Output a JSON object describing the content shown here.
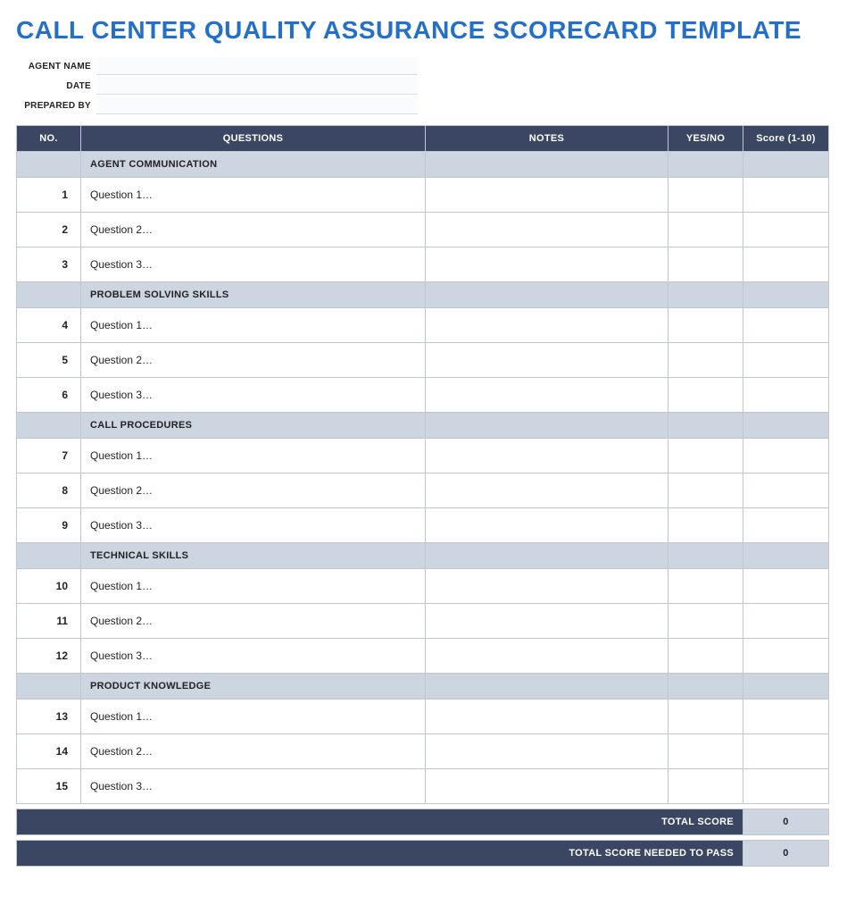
{
  "title": "CALL CENTER QUALITY ASSURANCE SCORECARD TEMPLATE",
  "meta": {
    "agent_name_label": "AGENT NAME",
    "agent_name_value": "",
    "date_label": "DATE",
    "date_value": "",
    "prepared_by_label": "PREPARED BY",
    "prepared_by_value": ""
  },
  "headers": {
    "no": "NO.",
    "questions": "QUESTIONS",
    "notes": "NOTES",
    "yes_no": "YES/NO",
    "score": "Score (1-10)"
  },
  "sections": [
    {
      "title": "AGENT COMMUNICATION",
      "rows": [
        {
          "no": "1",
          "question": "Question 1…",
          "notes": "",
          "yes_no": "",
          "score": ""
        },
        {
          "no": "2",
          "question": "Question 2…",
          "notes": "",
          "yes_no": "",
          "score": ""
        },
        {
          "no": "3",
          "question": "Question 3…",
          "notes": "",
          "yes_no": "",
          "score": ""
        }
      ]
    },
    {
      "title": "PROBLEM SOLVING SKILLS",
      "rows": [
        {
          "no": "4",
          "question": "Question 1…",
          "notes": "",
          "yes_no": "",
          "score": ""
        },
        {
          "no": "5",
          "question": "Question 2…",
          "notes": "",
          "yes_no": "",
          "score": ""
        },
        {
          "no": "6",
          "question": "Question 3…",
          "notes": "",
          "yes_no": "",
          "score": ""
        }
      ]
    },
    {
      "title": "CALL PROCEDURES",
      "rows": [
        {
          "no": "7",
          "question": "Question 1…",
          "notes": "",
          "yes_no": "",
          "score": ""
        },
        {
          "no": "8",
          "question": "Question 2…",
          "notes": "",
          "yes_no": "",
          "score": ""
        },
        {
          "no": "9",
          "question": "Question 3…",
          "notes": "",
          "yes_no": "",
          "score": ""
        }
      ]
    },
    {
      "title": "TECHNICAL SKILLS",
      "rows": [
        {
          "no": "10",
          "question": "Question 1…",
          "notes": "",
          "yes_no": "",
          "score": ""
        },
        {
          "no": "11",
          "question": "Question 2…",
          "notes": "",
          "yes_no": "",
          "score": ""
        },
        {
          "no": "12",
          "question": "Question 3…",
          "notes": "",
          "yes_no": "",
          "score": ""
        }
      ]
    },
    {
      "title": "PRODUCT KNOWLEDGE",
      "rows": [
        {
          "no": "13",
          "question": "Question 1…",
          "notes": "",
          "yes_no": "",
          "score": ""
        },
        {
          "no": "14",
          "question": "Question 2…",
          "notes": "",
          "yes_no": "",
          "score": ""
        },
        {
          "no": "15",
          "question": "Question 3…",
          "notes": "",
          "yes_no": "",
          "score": ""
        }
      ]
    }
  ],
  "totals": {
    "total_score_label": "TOTAL SCORE",
    "total_score_value": "0",
    "total_needed_label": "TOTAL SCORE NEEDED TO PASS",
    "total_needed_value": "0"
  }
}
